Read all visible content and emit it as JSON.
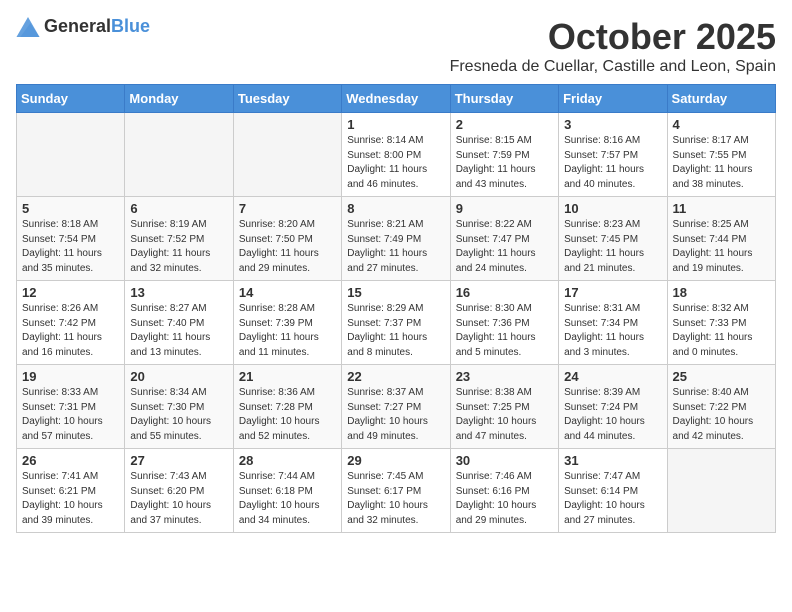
{
  "header": {
    "logo_general": "General",
    "logo_blue": "Blue",
    "month": "October 2025",
    "location": "Fresneda de Cuellar, Castille and Leon, Spain"
  },
  "days_of_week": [
    "Sunday",
    "Monday",
    "Tuesday",
    "Wednesday",
    "Thursday",
    "Friday",
    "Saturday"
  ],
  "weeks": [
    [
      {
        "day": "",
        "info": ""
      },
      {
        "day": "",
        "info": ""
      },
      {
        "day": "",
        "info": ""
      },
      {
        "day": "1",
        "info": "Sunrise: 8:14 AM\nSunset: 8:00 PM\nDaylight: 11 hours\nand 46 minutes."
      },
      {
        "day": "2",
        "info": "Sunrise: 8:15 AM\nSunset: 7:59 PM\nDaylight: 11 hours\nand 43 minutes."
      },
      {
        "day": "3",
        "info": "Sunrise: 8:16 AM\nSunset: 7:57 PM\nDaylight: 11 hours\nand 40 minutes."
      },
      {
        "day": "4",
        "info": "Sunrise: 8:17 AM\nSunset: 7:55 PM\nDaylight: 11 hours\nand 38 minutes."
      }
    ],
    [
      {
        "day": "5",
        "info": "Sunrise: 8:18 AM\nSunset: 7:54 PM\nDaylight: 11 hours\nand 35 minutes."
      },
      {
        "day": "6",
        "info": "Sunrise: 8:19 AM\nSunset: 7:52 PM\nDaylight: 11 hours\nand 32 minutes."
      },
      {
        "day": "7",
        "info": "Sunrise: 8:20 AM\nSunset: 7:50 PM\nDaylight: 11 hours\nand 29 minutes."
      },
      {
        "day": "8",
        "info": "Sunrise: 8:21 AM\nSunset: 7:49 PM\nDaylight: 11 hours\nand 27 minutes."
      },
      {
        "day": "9",
        "info": "Sunrise: 8:22 AM\nSunset: 7:47 PM\nDaylight: 11 hours\nand 24 minutes."
      },
      {
        "day": "10",
        "info": "Sunrise: 8:23 AM\nSunset: 7:45 PM\nDaylight: 11 hours\nand 21 minutes."
      },
      {
        "day": "11",
        "info": "Sunrise: 8:25 AM\nSunset: 7:44 PM\nDaylight: 11 hours\nand 19 minutes."
      }
    ],
    [
      {
        "day": "12",
        "info": "Sunrise: 8:26 AM\nSunset: 7:42 PM\nDaylight: 11 hours\nand 16 minutes."
      },
      {
        "day": "13",
        "info": "Sunrise: 8:27 AM\nSunset: 7:40 PM\nDaylight: 11 hours\nand 13 minutes."
      },
      {
        "day": "14",
        "info": "Sunrise: 8:28 AM\nSunset: 7:39 PM\nDaylight: 11 hours\nand 11 minutes."
      },
      {
        "day": "15",
        "info": "Sunrise: 8:29 AM\nSunset: 7:37 PM\nDaylight: 11 hours\nand 8 minutes."
      },
      {
        "day": "16",
        "info": "Sunrise: 8:30 AM\nSunset: 7:36 PM\nDaylight: 11 hours\nand 5 minutes."
      },
      {
        "day": "17",
        "info": "Sunrise: 8:31 AM\nSunset: 7:34 PM\nDaylight: 11 hours\nand 3 minutes."
      },
      {
        "day": "18",
        "info": "Sunrise: 8:32 AM\nSunset: 7:33 PM\nDaylight: 11 hours\nand 0 minutes."
      }
    ],
    [
      {
        "day": "19",
        "info": "Sunrise: 8:33 AM\nSunset: 7:31 PM\nDaylight: 10 hours\nand 57 minutes."
      },
      {
        "day": "20",
        "info": "Sunrise: 8:34 AM\nSunset: 7:30 PM\nDaylight: 10 hours\nand 55 minutes."
      },
      {
        "day": "21",
        "info": "Sunrise: 8:36 AM\nSunset: 7:28 PM\nDaylight: 10 hours\nand 52 minutes."
      },
      {
        "day": "22",
        "info": "Sunrise: 8:37 AM\nSunset: 7:27 PM\nDaylight: 10 hours\nand 49 minutes."
      },
      {
        "day": "23",
        "info": "Sunrise: 8:38 AM\nSunset: 7:25 PM\nDaylight: 10 hours\nand 47 minutes."
      },
      {
        "day": "24",
        "info": "Sunrise: 8:39 AM\nSunset: 7:24 PM\nDaylight: 10 hours\nand 44 minutes."
      },
      {
        "day": "25",
        "info": "Sunrise: 8:40 AM\nSunset: 7:22 PM\nDaylight: 10 hours\nand 42 minutes."
      }
    ],
    [
      {
        "day": "26",
        "info": "Sunrise: 7:41 AM\nSunset: 6:21 PM\nDaylight: 10 hours\nand 39 minutes."
      },
      {
        "day": "27",
        "info": "Sunrise: 7:43 AM\nSunset: 6:20 PM\nDaylight: 10 hours\nand 37 minutes."
      },
      {
        "day": "28",
        "info": "Sunrise: 7:44 AM\nSunset: 6:18 PM\nDaylight: 10 hours\nand 34 minutes."
      },
      {
        "day": "29",
        "info": "Sunrise: 7:45 AM\nSunset: 6:17 PM\nDaylight: 10 hours\nand 32 minutes."
      },
      {
        "day": "30",
        "info": "Sunrise: 7:46 AM\nSunset: 6:16 PM\nDaylight: 10 hours\nand 29 minutes."
      },
      {
        "day": "31",
        "info": "Sunrise: 7:47 AM\nSunset: 6:14 PM\nDaylight: 10 hours\nand 27 minutes."
      },
      {
        "day": "",
        "info": ""
      }
    ]
  ]
}
